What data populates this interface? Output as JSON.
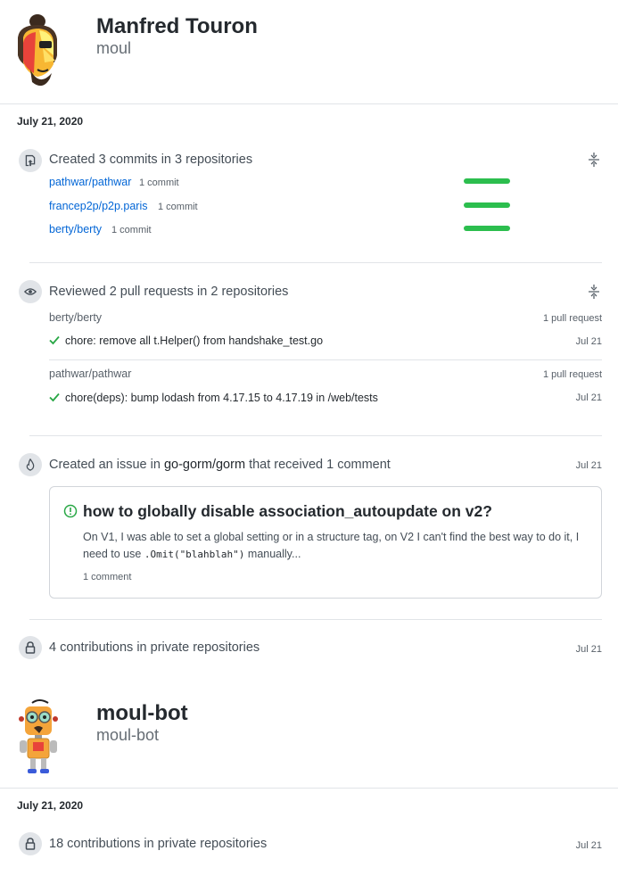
{
  "users": [
    {
      "name": "Manfred Touron",
      "login": "moul",
      "date": "July 21, 2020",
      "commits": {
        "title": "Created 3 commits in 3 repositories",
        "repos": [
          {
            "name": "pathwar/pathwar",
            "count": "1 commit",
            "fraction": 1.0
          },
          {
            "name": "francep2p/p2p.paris",
            "count": "1 commit",
            "fraction": 1.0
          },
          {
            "name": "berty/berty",
            "count": "1 commit",
            "fraction": 1.0
          }
        ]
      },
      "reviews": {
        "title": "Reviewed 2 pull requests in 2 repositories",
        "groups": [
          {
            "repo": "berty/berty",
            "count": "1 pull request",
            "pr_title": "chore: remove all t.Helper() from handshake_test.go",
            "date": "Jul 21"
          },
          {
            "repo": "pathwar/pathwar",
            "count": "1 pull request",
            "pr_title": "chore(deps): bump lodash from 4.17.15 to 4.17.19 in /web/tests",
            "date": "Jul 21"
          }
        ]
      },
      "issue": {
        "prefix": "Created an issue in",
        "repo": "go-gorm/gorm",
        "suffix": "that received 1 comment",
        "date": "Jul 21",
        "title": "how to globally disable association_autoupdate on v2?",
        "body_before": "On V1, I was able to set a global setting or in a structure tag, on V2 I can't find the best way to do it, I need to use",
        "body_code": ".Omit(\"blahblah\")",
        "body_after": "manually...",
        "comments": "1 comment"
      },
      "private": {
        "title": "4 contributions in private repositories",
        "date": "Jul 21"
      }
    },
    {
      "name": "moul-bot",
      "login": "moul-bot",
      "date": "July 21, 2020",
      "private": {
        "title": "18 contributions in private repositories",
        "date": "Jul 21"
      }
    }
  ],
  "colors": {
    "link": "#0366d6",
    "bar": "#2cbe4e",
    "check": "#28a745",
    "open_issue": "#28a745"
  },
  "icons": [
    "avatar-moul",
    "repo-push-icon",
    "eye-icon",
    "issue-opened-activity-icon",
    "lock-icon",
    "fold-icon",
    "check-icon",
    "issue-opened-icon",
    "avatar-moul-bot"
  ]
}
